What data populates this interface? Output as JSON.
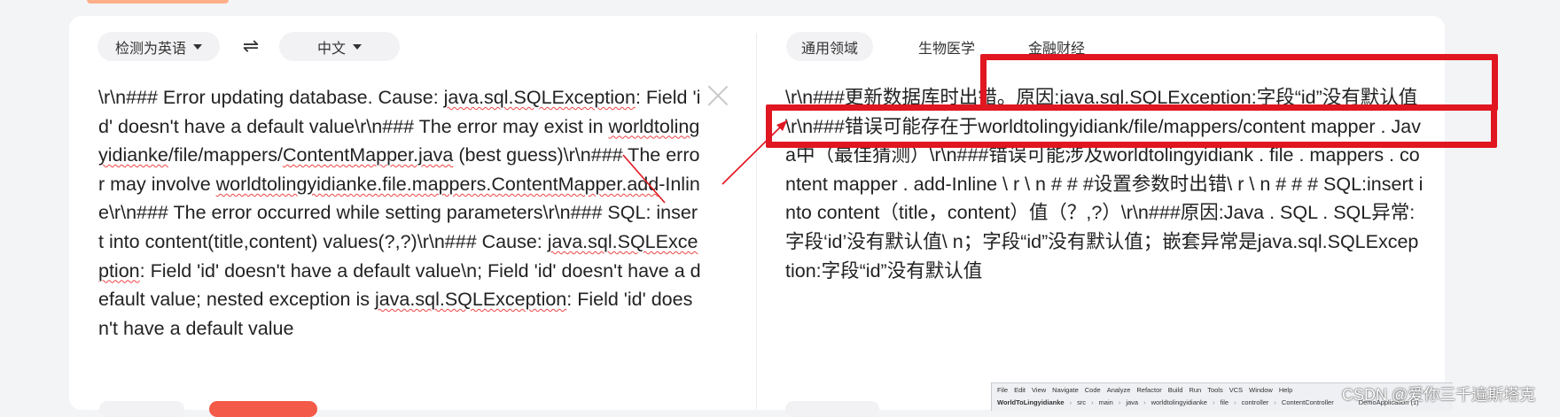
{
  "lang_bar": {
    "source_lang": "检测为英语",
    "swap_symbol": "⇌",
    "target_lang": "中文"
  },
  "domains": [
    "通用领域",
    "生物医学",
    "金融财经"
  ],
  "source": {
    "text": "\\r\\n### Error updating database.  Cause: java.sql.SQLException: Field 'id' doesn't have a default value\\r\\n### The error may exist in worldtolingyidianke/file/mappers/ContentMapper.java (best guess)\\r\\n### The error may involve worldtolingyidianke.file.mappers.ContentMapper.add-Inline\\r\\n### The error occurred while setting parameters\\r\\n### SQL: insert into content(title,content) values(?,?)\\r\\n### Cause: java.sql.SQLException: Field 'id' doesn't have a default value\\n; Field 'id' doesn't have a default value; nested exception is java.sql.SQLException: Field 'id' doesn't have a default value"
  },
  "translation": {
    "text": "\\r\\n###更新数据库时出错。原因:java.sql.SQLException:字段“id”没有默认值\\r\\n###错误可能存在于worldtolingyidiank/file/mappers/content mapper . Java中（最佳猜测）\\r\\n###错误可能涉及worldtolingyidiank . file . mappers . content mapper . add-Inline \\ r \\ n # # #设置参数时出错\\ r \\ n # # # SQL:insert into content（title，content）值（？,?）\\r\\n###原因:Java . SQL . SQL异常:字段‘id’没有默认值\\ n；字段“id”没有默认值；嵌套异常是java.sql.SQLException:字段“id”没有默认值"
  },
  "ide": {
    "menu": [
      "File",
      "Edit",
      "View",
      "Navigate",
      "Code",
      "Analyze",
      "Refactor",
      "Build",
      "Run",
      "Tools",
      "VCS",
      "Window",
      "Help"
    ],
    "project": "WorldToLingyidianke",
    "path": [
      "src",
      "main",
      "java",
      "worldtolingyidianke",
      "file",
      "controller",
      "ContentController"
    ],
    "run_config": "DemoApplication (1)"
  },
  "watermark": "CSDN @爱你三千遍斯塔克",
  "colors": {
    "annotation": "#e01620",
    "spell_underline": "#e44"
  }
}
